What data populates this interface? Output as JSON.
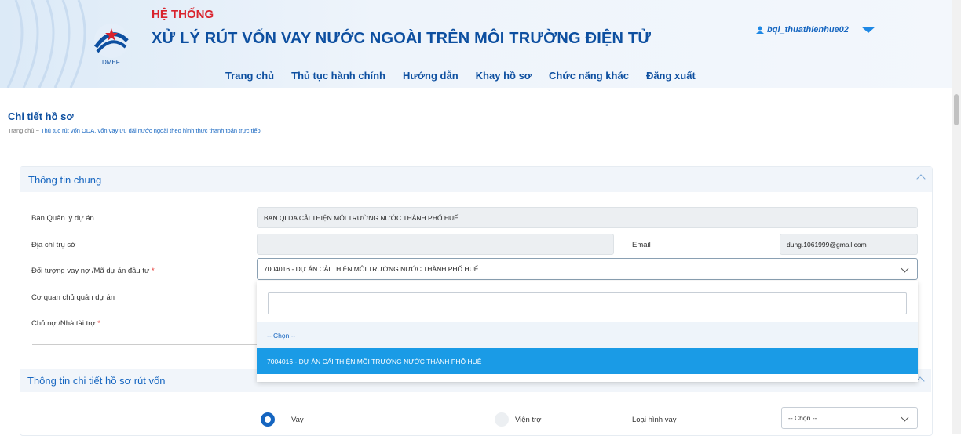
{
  "header": {
    "system_label": "HỆ THỐNG",
    "system_title": "XỬ LÝ RÚT VỐN VAY NƯỚC NGOÀI TRÊN MÔI TRƯỜNG ĐIỆN TỬ",
    "logo_text": "DMEF",
    "user": "bql_thuathienhue02",
    "nav": [
      "Trang chủ",
      "Thủ tục hành chính",
      "Hướng dẫn",
      "Khay hồ sơ",
      "Chức năng khác",
      "Đăng xuất"
    ]
  },
  "page": {
    "title": "Chi tiết hồ sơ",
    "breadcrumb_home": "Trang chủ",
    "breadcrumb_sep": "−",
    "breadcrumb_current": "Thủ tục rút vốn ODA, vốn vay ưu đãi nước ngoài theo hình thức thanh toán trực tiếp"
  },
  "general": {
    "heading": "Thông tin chung",
    "ban_label": "Ban Quản lý dự án",
    "ban_value": "BAN QLDA CẢI THIỆN MÔI TRƯỜNG NƯỚC THÀNH PHỐ HUẾ",
    "address_label": "Địa chỉ trụ sở",
    "address_value": "",
    "email_label": "Email",
    "email_value": "dung.1061999@gmail.com",
    "borrower_label": "Đối tượng vay nợ /Mã dự án đầu tư",
    "borrower_value": "7004016 - DỰ ÁN CẢI THIỆN MÔI TRƯỜNG NƯỚC THÀNH PHỐ HUẾ",
    "agency_label": "Cơ quan chủ quản dự án",
    "lender_label": "Chủ nợ /Nhà tài trợ",
    "required_mark": "*"
  },
  "dropdown": {
    "search_value": "",
    "options": [
      "-- Chọn --",
      "7004016 - DỰ ÁN CẢI THIỆN MÔI TRƯỜNG NƯỚC THÀNH PHỐ HUẾ"
    ]
  },
  "detail": {
    "heading": "Thông tin chi tiết hồ sơ rút vốn",
    "radio_loan": "Vay",
    "radio_aid": "Viện trợ",
    "loan_type_label": "Loại hình vay",
    "loan_type_value": "-- Chọn --"
  },
  "colors": {
    "primary": "#0d4fa0",
    "accent": "#1a9be6",
    "alert": "#d9232d"
  }
}
